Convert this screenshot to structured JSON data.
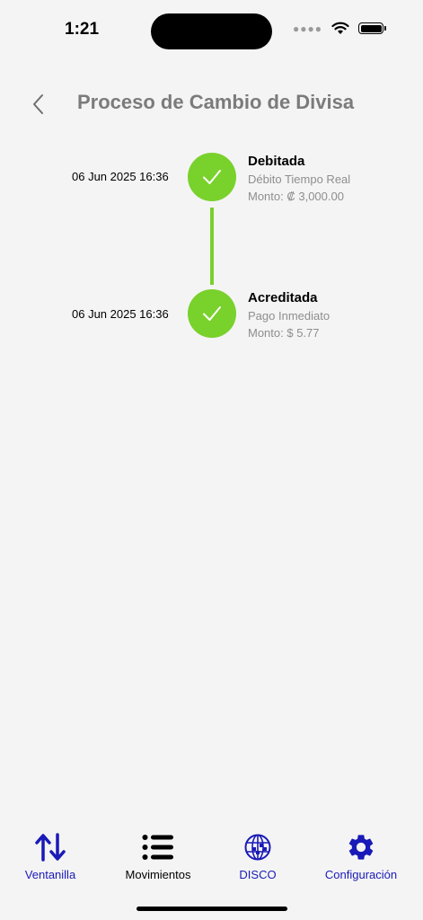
{
  "status_bar": {
    "time": "1:21"
  },
  "header": {
    "title": "Proceso de Cambio de Divisa"
  },
  "steps": [
    {
      "date": "06 Jun 2025 16:36",
      "title": "Debitada",
      "subtitle": "Débito Tiempo Real",
      "amount": "Monto: ₡ 3,000.00",
      "status": "completed"
    },
    {
      "date": "06 Jun 2025 16:36",
      "title": "Acreditada",
      "subtitle": "Pago Inmediato",
      "amount": "Monto: $ 5.77",
      "status": "completed"
    }
  ],
  "colors": {
    "success": "#79d12c",
    "tab_accent": "#1a1ab8",
    "title_gray": "#7b7b7b"
  },
  "tabbar": {
    "items": [
      {
        "label": "Ventanilla",
        "icon": "arrows-up-down-icon"
      },
      {
        "label": "Movimientos",
        "icon": "list-icon"
      },
      {
        "label": "DISCO",
        "icon": "globe-icon"
      },
      {
        "label": "Configuración",
        "icon": "gear-icon"
      }
    ]
  }
}
